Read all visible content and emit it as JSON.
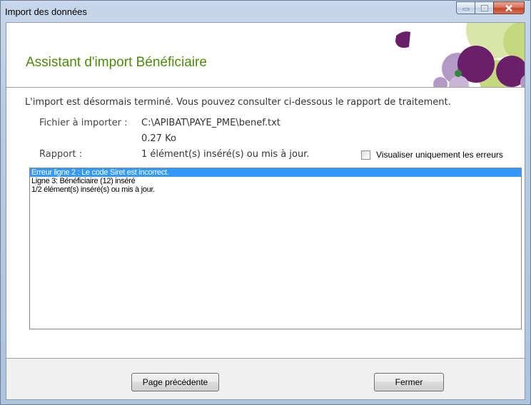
{
  "window": {
    "title": "Import des données"
  },
  "header": {
    "title": "Assistant d'import Bénéficiaire"
  },
  "content": {
    "intro": "L'import est désormais terminé. Vous pouvez consulter ci-dessous le rapport de traitement.",
    "file_label": "Fichier à importer :",
    "file_path": "C:\\APIBAT\\PAYE_PME\\benef.txt",
    "file_size": "0.27 Ko",
    "report_label": "Rapport :",
    "report_summary": "1 élément(s) inséré(s) ou mis à jour.",
    "errors_only_label": "Visualiser uniquement les erreurs",
    "errors_only_checked": false
  },
  "report_lines": [
    "Erreur ligne 2 : Le code Siret est incorrect.",
    "Ligne 3: Bénéficiaire  (12) inséré",
    "1/2 élément(s) inséré(s) ou mis à jour."
  ],
  "footer": {
    "prev_label": "Page précédente",
    "close_label": "Fermer"
  },
  "colors": {
    "header_title": "#4c8a0c",
    "selection": "#3399ff",
    "deco_green": "#c5d87e",
    "deco_purple": "#6b1f6b",
    "deco_lilac": "#b39ac6"
  }
}
